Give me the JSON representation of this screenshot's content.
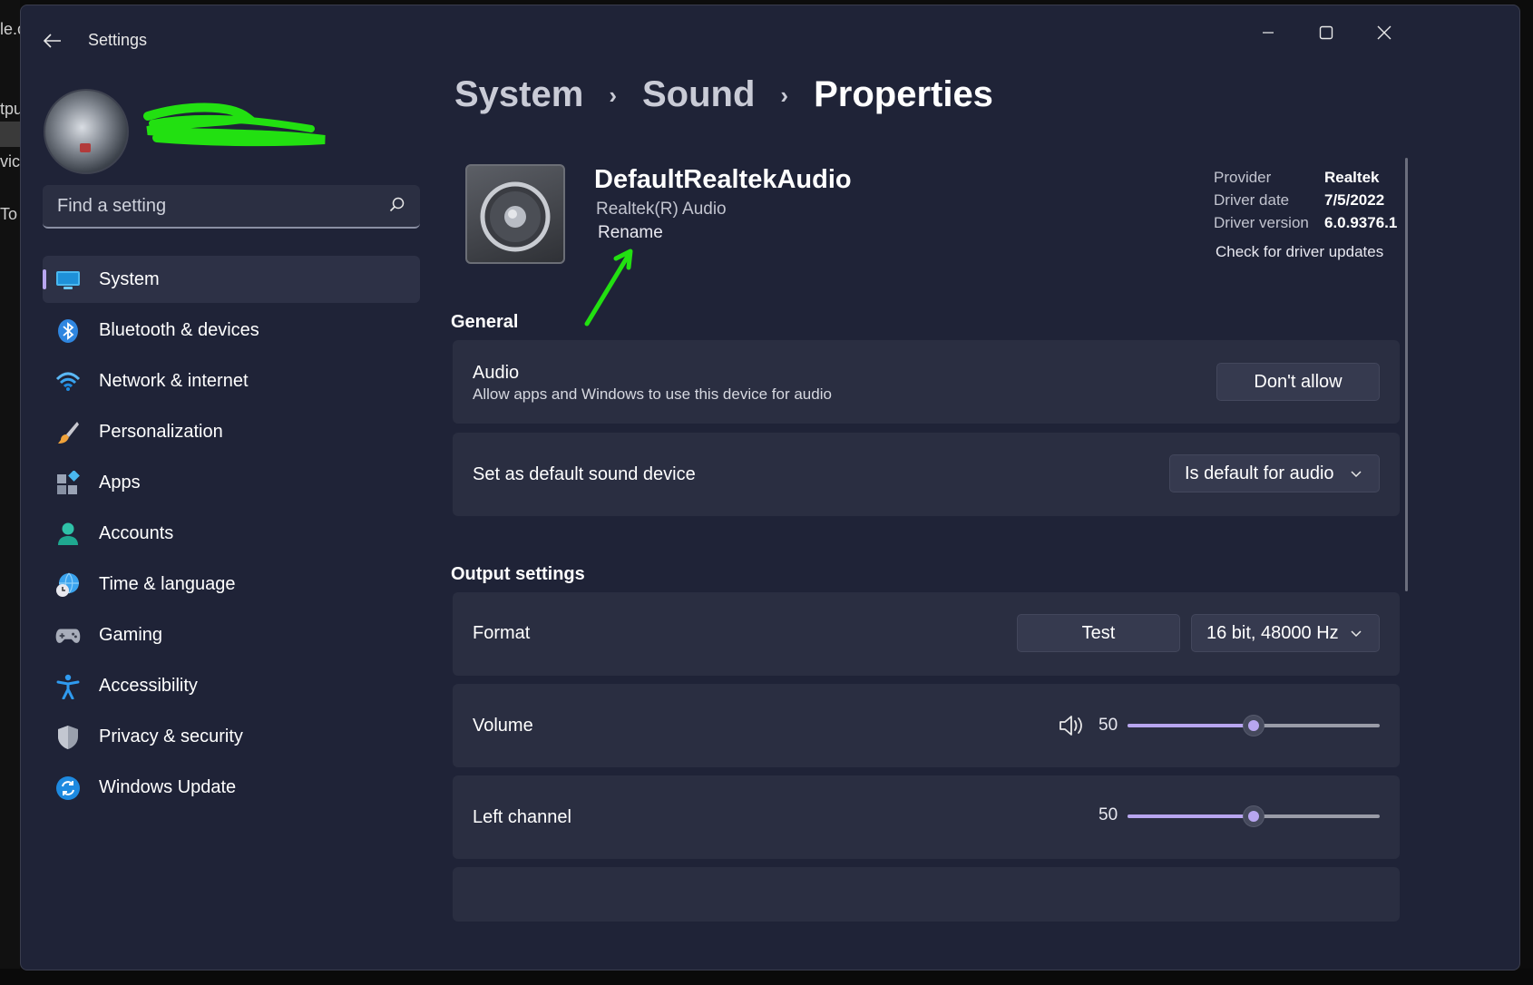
{
  "background": {
    "fragments": [
      "le.c",
      "tpu",
      "vice",
      "To"
    ]
  },
  "window": {
    "title": "Settings"
  },
  "user": {
    "avatar_alt": "avatar"
  },
  "search": {
    "placeholder": "Find a setting"
  },
  "nav": {
    "items": [
      {
        "label": "System",
        "icon": "system-icon",
        "active": true
      },
      {
        "label": "Bluetooth & devices",
        "icon": "bluetooth-icon"
      },
      {
        "label": "Network & internet",
        "icon": "wifi-icon"
      },
      {
        "label": "Personalization",
        "icon": "brush-icon"
      },
      {
        "label": "Apps",
        "icon": "apps-icon"
      },
      {
        "label": "Accounts",
        "icon": "person-icon"
      },
      {
        "label": "Time & language",
        "icon": "globe-clock-icon"
      },
      {
        "label": "Gaming",
        "icon": "gamepad-icon"
      },
      {
        "label": "Accessibility",
        "icon": "accessibility-icon"
      },
      {
        "label": "Privacy & security",
        "icon": "shield-icon"
      },
      {
        "label": "Windows Update",
        "icon": "update-icon"
      }
    ]
  },
  "breadcrumb": {
    "items": [
      "System",
      "Sound",
      "Properties"
    ]
  },
  "device": {
    "name": "DefaultRealtekAudio",
    "subtitle": "Realtek(R) Audio",
    "rename_label": "Rename"
  },
  "driver": {
    "rows": [
      {
        "key": "Provider",
        "value": "Realtek"
      },
      {
        "key": "Driver date",
        "value": "7/5/2022"
      },
      {
        "key": "Driver version",
        "value": "6.0.9376.1"
      }
    ],
    "update_link": "Check for driver updates"
  },
  "general": {
    "heading": "General",
    "audio": {
      "title": "Audio",
      "description": "Allow apps and Windows to use this device for audio",
      "button": "Don't allow"
    },
    "default_device": {
      "title": "Set as default sound device",
      "selected": "Is default for audio"
    }
  },
  "output": {
    "heading": "Output settings",
    "format": {
      "title": "Format",
      "test_button": "Test",
      "selected": "16 bit, 48000 Hz"
    },
    "volume": {
      "title": "Volume",
      "value": "50",
      "level": 0.5
    },
    "left_channel": {
      "title": "Left channel",
      "value": "50",
      "level": 0.5
    }
  },
  "colors": {
    "accent": "#b8a6f0",
    "window_bg": "#1f2337",
    "card_bg": "#2a2e41",
    "annotation_green": "#22e011"
  }
}
